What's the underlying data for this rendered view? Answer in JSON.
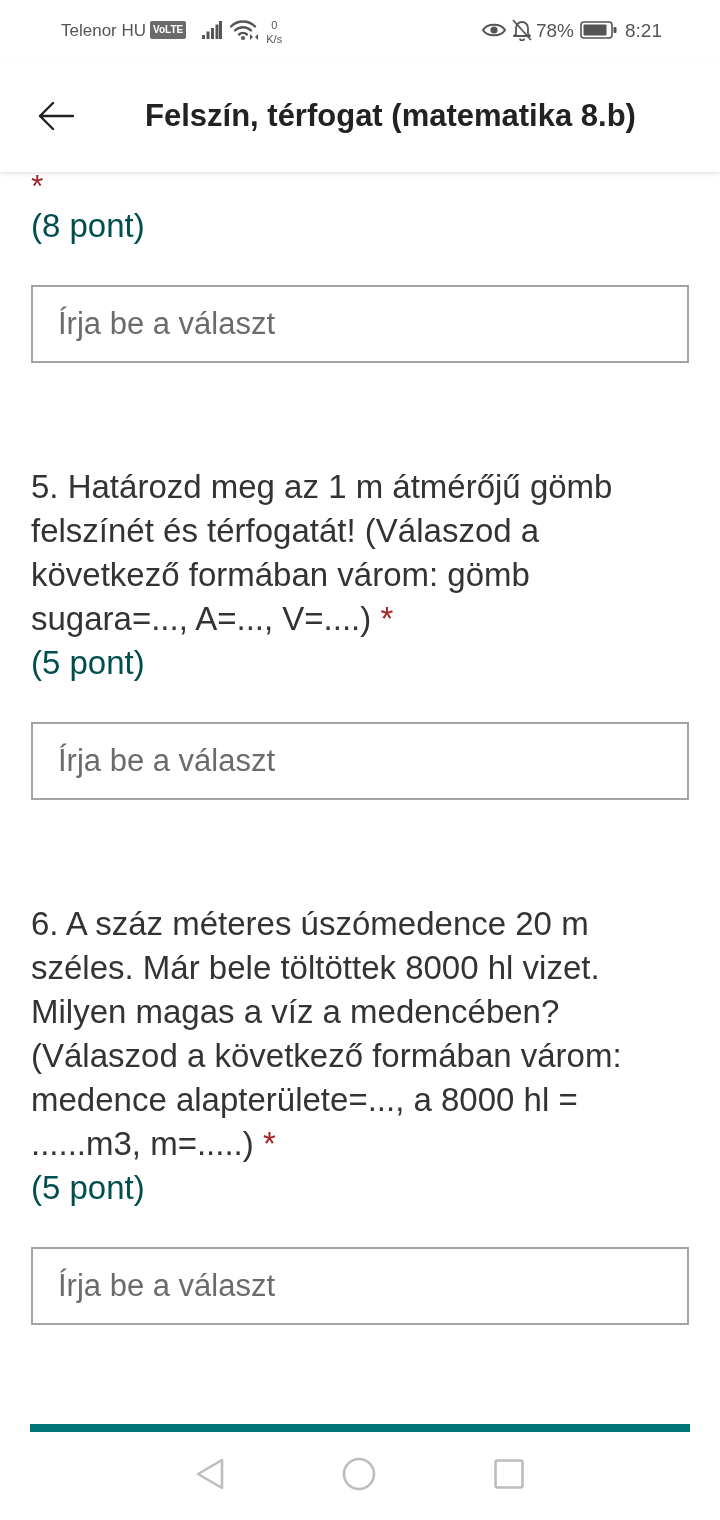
{
  "status_bar": {
    "carrier": "Telenor HU",
    "network_badge": "VoLTE",
    "speed_value": "0",
    "speed_unit": "K/s",
    "battery_percent": "78%",
    "time": "8:21"
  },
  "header": {
    "title": "Felszín, térfogat (matematika 8.b)"
  },
  "questions": [
    {
      "required_mark": "*",
      "points": "(8 pont)",
      "answer": {
        "placeholder": "Írja be a választ"
      }
    },
    {
      "text": "5. Határozd meg az 1 m átmérőjű gömb felszínét és térfogatát! (Válaszod a következő formában várom: gömb sugara=..., A=..., V=....)",
      "required_mark": "*",
      "points": "(5 pont)",
      "answer": {
        "placeholder": "Írja be a választ"
      }
    },
    {
      "text": "6. A száz méteres úszómedence 20 m széles. Már bele töltöttek 8000 hl vizet. Milyen magas a víz a medencében? (Válaszod a következő formában várom: medence alapterülete=..., a 8000 hl = ......m3, m=.....)",
      "required_mark": "*",
      "points": "(5 pont)",
      "answer": {
        "placeholder": "Írja be a választ"
      }
    }
  ]
}
